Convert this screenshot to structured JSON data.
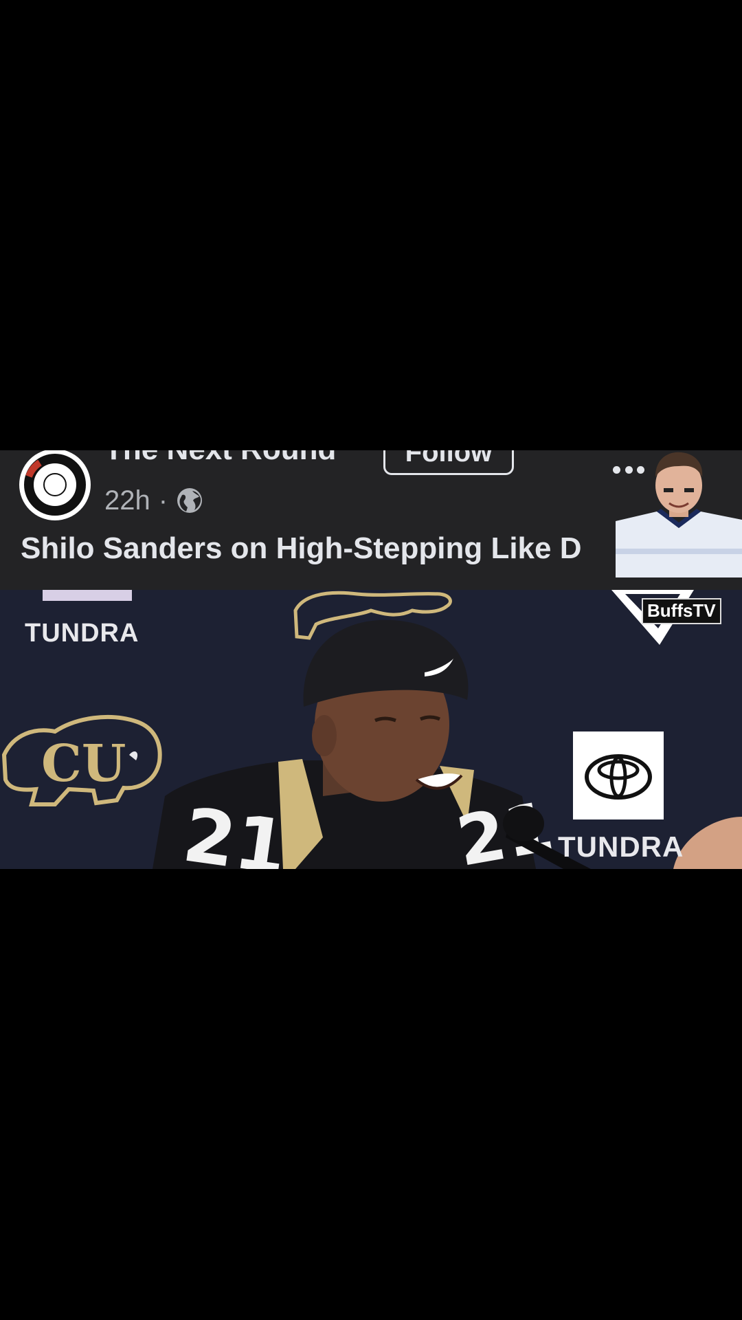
{
  "post": {
    "page_name": "The Next Round",
    "follow_label": "Follow",
    "timestamp": "22h",
    "separator": "·",
    "privacy_icon": "globe-icon",
    "more_icon": "more-icon",
    "title": "Shilo Sanders on High-Stepping Like D"
  },
  "video": {
    "sponsor_left": "TUNDRA",
    "sponsor_right": "TUNDRA",
    "watermark": "BuffsTV",
    "jersey_number": "21"
  },
  "colors": {
    "background": "#000000",
    "header_bg": "#232325",
    "text_primary": "#e4e6eb",
    "text_secondary": "#b0b3b8",
    "video_bg": "#1d2133",
    "cu_gold": "#cfb87c"
  }
}
